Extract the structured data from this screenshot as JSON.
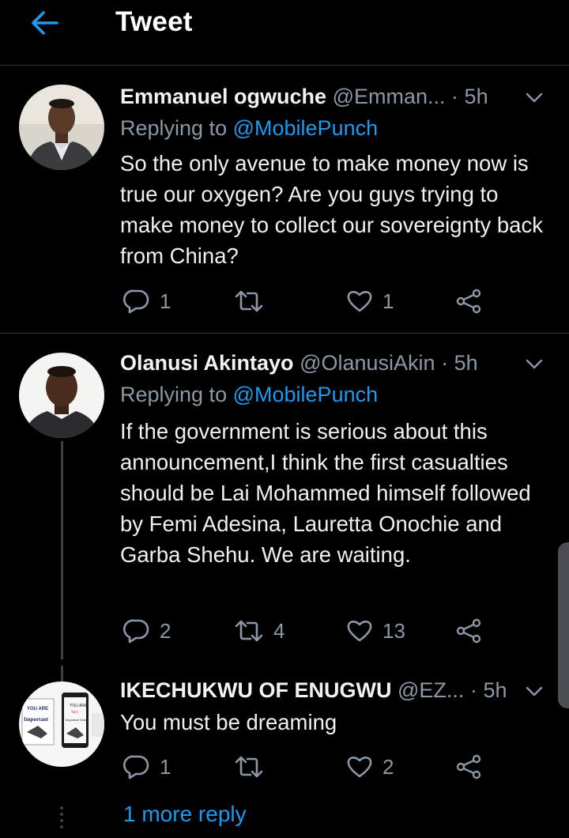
{
  "header": {
    "title": "Tweet",
    "back_icon": "arrow-left-icon"
  },
  "colors": {
    "background": "#000000",
    "accent": "#1d9bf0",
    "muted": "#8b98a5",
    "divider": "#2f3336"
  },
  "tweets": [
    {
      "name": "Emmanuel ogwuche",
      "handle": "@Emman...",
      "separator": "·",
      "time": "5h",
      "replying_prefix": "Replying to",
      "replying_to": "@MobilePunch",
      "text": "So the only avenue to make money now is true our oxygen? Are you guys trying to make money to collect our sovereignty back from China?",
      "replies": "1",
      "retweets": "",
      "likes": "1"
    },
    {
      "name": "Olanusi Akintayo",
      "handle": "@OlanusiAkin",
      "separator": "·",
      "time": "5h",
      "replying_prefix": "Replying to",
      "replying_to": "@MobilePunch",
      "text": "If the government is serious about this announcement,I think the first casualties should be Lai Mohammed himself followed by Femi Adesina, Lauretta Onochie and Garba Shehu. We are waiting.",
      "replies": "2",
      "retweets": "4",
      "likes": "13"
    },
    {
      "name": "IKECHUKWU OF ENUGWU",
      "handle": "@EZ...",
      "separator": "·",
      "time": "5h",
      "text": "You must be dreaming",
      "replies": "1",
      "retweets": "",
      "likes": "2"
    }
  ],
  "thread": {
    "more_replies": "1 more reply"
  },
  "avatar3_book": {
    "line1": "YOU ARE",
    "line2": "Important",
    "line3": "Very",
    "line4": "Important Years"
  }
}
